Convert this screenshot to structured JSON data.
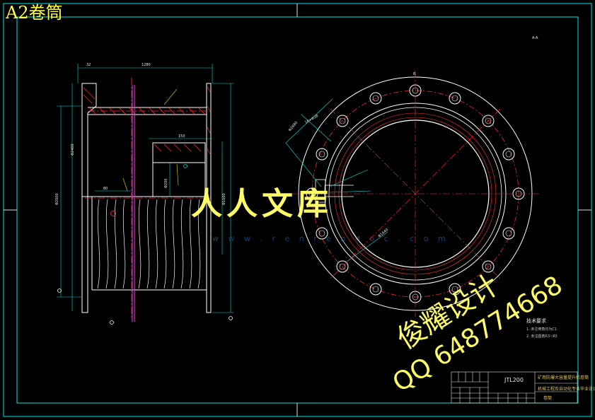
{
  "title": "A2卷筒",
  "watermark": {
    "designer": "俊耀设计",
    "qq": "QQ 648774668",
    "site_cn": "人人文库",
    "site_url": "w w w . r e n r e n d o c . c o m"
  },
  "title_block": {
    "code": "JTL200",
    "row1": "矿用防爆大容量提升机卷筒",
    "row2": "机械工程及自动化专业毕业设计",
    "row3": "卷筒"
  },
  "tech_notes": {
    "heading": "技术要求",
    "lines": [
      "1. 未注倒角均为C1",
      "2. 未注圆角R3~R5"
    ]
  },
  "colors": {
    "frame": "#00e5e5",
    "outline": "#ffffff",
    "center_line": "#ff3333",
    "dimension": "#00d9d9",
    "hatch": "#ff4040",
    "title_text": "#ffff3a",
    "watermark": "#fffc66"
  }
}
